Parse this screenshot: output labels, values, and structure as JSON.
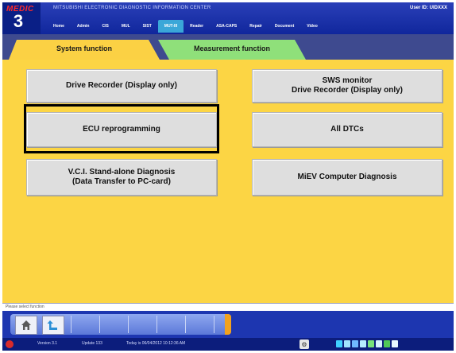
{
  "header": {
    "logo_top": "MEDIC",
    "logo_num": "3",
    "app_title": "MITSUBISHI ELECTRONIC DIAGNOSTIC INFORMATION CENTER",
    "user_id": "User ID: UIDXXX",
    "menu": [
      "Home",
      "Admin",
      "CIS",
      "MUL",
      "SIST",
      "MUT-III",
      "Reader",
      "ASA-CAPS",
      "Repair",
      "Document",
      "Video"
    ],
    "active_menu": "MUT-III"
  },
  "tabs": {
    "system": "System function",
    "measurement": "Measurement function"
  },
  "functions": {
    "drive_recorder": [
      "Drive Recorder (Display only)"
    ],
    "sws_monitor": [
      "SWS monitor",
      "Drive Recorder (Display only)"
    ],
    "ecu_reprogramming": [
      "ECU reprogramming"
    ],
    "all_dtcs": [
      "All DTCs"
    ],
    "vci_standalone": [
      "V.C.I. Stand-alone Diagnosis",
      "(Data Transfer to PC-card)"
    ],
    "miev": [
      "MiEV Computer Diagnosis"
    ]
  },
  "status_message": "Please select function",
  "footer": {
    "version": "Version 3.1",
    "update": "Update 133",
    "today": "Today is 06/04/2012 10:12:36 AM"
  },
  "icons": {
    "home": "home-icon",
    "back": "back-arrow-icon"
  },
  "colors": {
    "content_bg": "#fcd544",
    "system_tab": "#fbd144",
    "measurement_tab": "#8fe07a",
    "header_bg": "#10279c",
    "nav_accent": "#f2a21e"
  }
}
